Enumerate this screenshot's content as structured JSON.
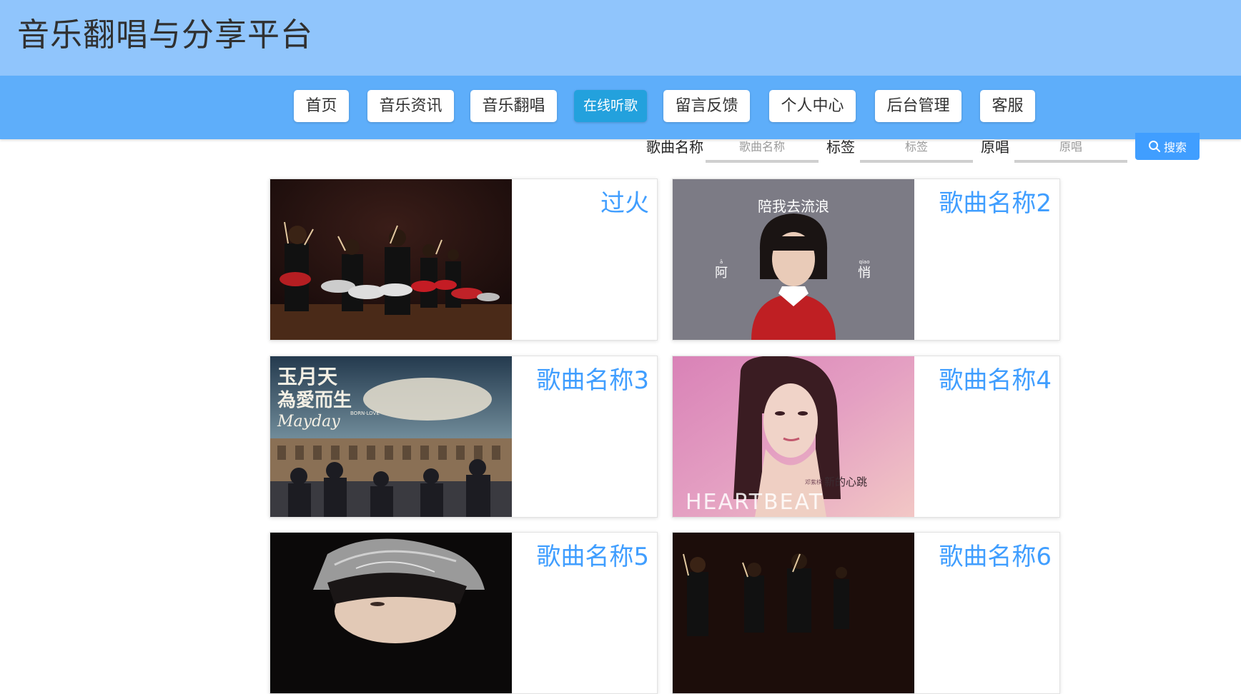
{
  "header": {
    "title": "音乐翻唱与分享平台"
  },
  "nav": {
    "items": [
      {
        "label": "首页"
      },
      {
        "label": "音乐资讯"
      },
      {
        "label": "音乐翻唱"
      },
      {
        "label": "在线听歌",
        "active": true
      },
      {
        "label": "留言反馈"
      },
      {
        "label": "个人中心"
      },
      {
        "label": "后台管理"
      },
      {
        "label": "客服"
      }
    ]
  },
  "search": {
    "song_label": "歌曲名称",
    "song_placeholder": "歌曲名称",
    "tag_label": "标签",
    "tag_placeholder": "标签",
    "original_label": "原唱",
    "original_placeholder": "原唱",
    "button_label": "搜索",
    "button_icon": "search-icon"
  },
  "songs": [
    {
      "title": "过火"
    },
    {
      "title": "歌曲名称2",
      "cover_text": {
        "top": "陪我去流浪",
        "left": "阿",
        "left_pinyin": "ā",
        "right": "悄",
        "right_pinyin": "qiao"
      }
    },
    {
      "title": "歌曲名称3",
      "cover_text": {
        "line1": "玉月天",
        "line2": "為愛而生",
        "small": "BORN·LOVE",
        "brand": "Mayday"
      }
    },
    {
      "title": "歌曲名称4",
      "cover_text": {
        "artist": "邓紫棋",
        "cn": "新的心跳",
        "en": "HEARTBEAT"
      }
    },
    {
      "title": "歌曲名称5"
    },
    {
      "title": "歌曲名称6"
    }
  ],
  "colors": {
    "header_bg": "#90c5fc",
    "nav_bg": "#5eaefa",
    "active_nav": "#23a1dd",
    "accent": "#409eff"
  }
}
